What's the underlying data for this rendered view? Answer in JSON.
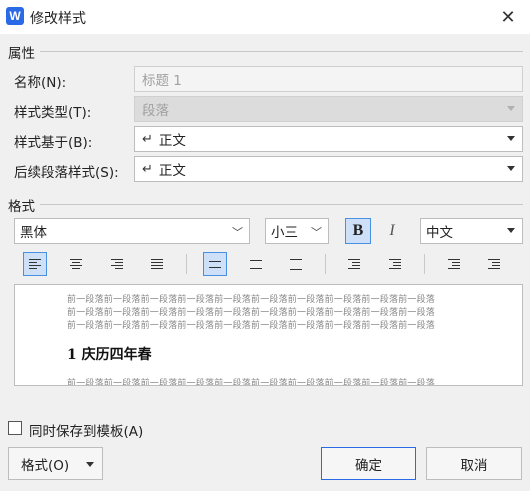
{
  "window": {
    "title": "修改样式",
    "app_icon_letter": "W",
    "close_glyph": "✕"
  },
  "properties": {
    "section": "属性",
    "name_label": "名称(N):",
    "name_value": "标题 1",
    "style_type_label": "样式类型(T):",
    "style_type_value": "段落",
    "based_on_label": "样式基于(B):",
    "based_on_value": "正文",
    "following_label": "后续段落样式(S):",
    "following_value": "正文",
    "return_glyph": "↵"
  },
  "format": {
    "section": "格式",
    "font": "黑体",
    "size": "小三",
    "bold_label": "B",
    "italic_label": "I",
    "script": "中文",
    "bold_active": true,
    "italic_active": false
  },
  "toolbar": {
    "align_left_active": true,
    "line_spacing_single_active": true
  },
  "preview": {
    "sample_text": "前一段落前一段落前一段落前一段落前一段落前一段落前一段落前一段落前一段落前一段落",
    "heading": "1 庆历四年春"
  },
  "options": {
    "save_to_template_label": "同时保存到模板(A)",
    "save_to_template_checked": false
  },
  "buttons": {
    "format": "格式(O)",
    "ok": "确定",
    "cancel": "取消"
  },
  "colors": {
    "accent": "#2b6ae6",
    "active_fill": "#cde0f7"
  }
}
